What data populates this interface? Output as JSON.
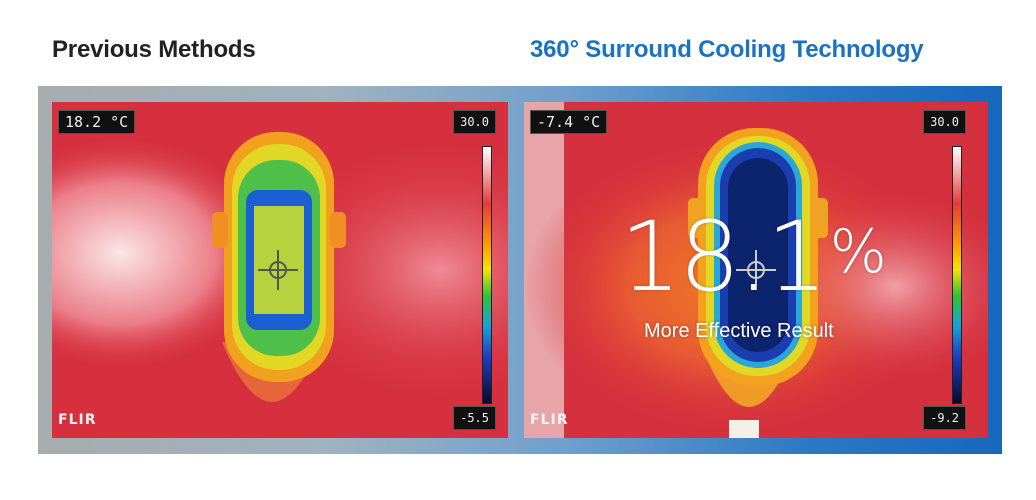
{
  "headings": {
    "left": "Previous Methods",
    "right": "360° Surround Cooling Technology"
  },
  "left_panel": {
    "temp_readout": "18.2 °C",
    "scale_max": "30.0",
    "scale_min": "-5.5",
    "brand": "FLIR"
  },
  "right_panel": {
    "temp_readout": "-7.4 °C",
    "scale_max": "30.0",
    "scale_min": "-9.2",
    "brand": "FLIR",
    "highlight_value": "18.1",
    "highlight_unit": "%",
    "highlight_caption": "More Effective Result"
  },
  "colors": {
    "heading_right": "#1a72c2",
    "heading_left": "#222222"
  }
}
